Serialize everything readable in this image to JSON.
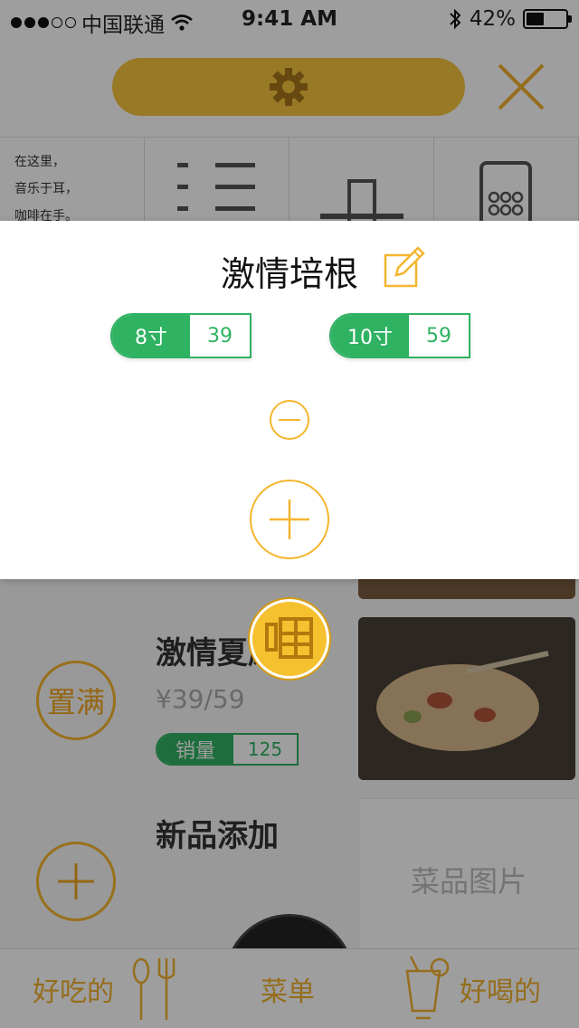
{
  "status_bar": {
    "signal_dots_filled": 3,
    "signal_dots_empty": 2,
    "carrier": "中国联通",
    "time": "9:41 AM",
    "battery_percent": "42%"
  },
  "category_strip": {
    "poem_lines": [
      "在这里，",
      "音乐于耳，",
      "咖啡在手。"
    ]
  },
  "menu_items": [
    {
      "title": "激情夏威",
      "price": "¥39/59",
      "badge_label": "置满",
      "sales_label": "销量",
      "sales_count": "125"
    },
    {
      "title": "新品添加",
      "photo_placeholder": "菜品图片"
    }
  ],
  "modal": {
    "title": "激情培根",
    "sizes": [
      {
        "size": "8寸",
        "price": "39"
      },
      {
        "size": "10寸",
        "price": "59"
      }
    ]
  },
  "tabbar": {
    "left": "好吃的",
    "center": "菜单",
    "right": "好喝的"
  },
  "colors": {
    "accent_yellow": "#f6c12e",
    "accent_green": "#2fb262"
  }
}
